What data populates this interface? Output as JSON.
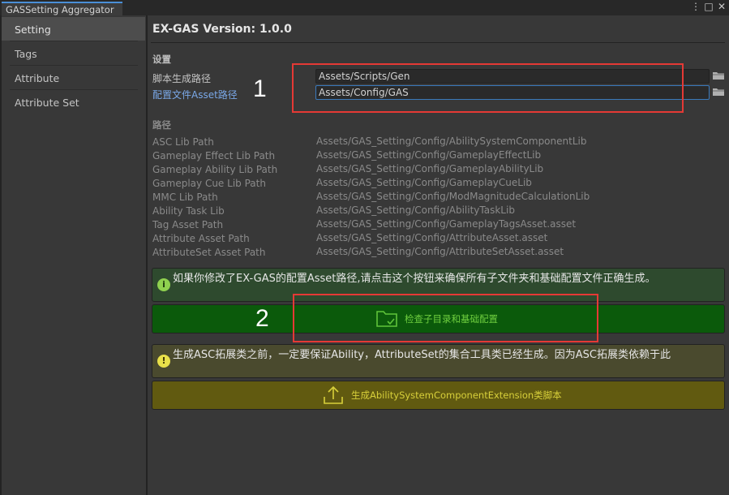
{
  "window": {
    "tab_title": "GASSetting Aggregator",
    "menu_icon": "⋮",
    "maximize_icon": "□",
    "close_icon": "✕"
  },
  "sidebar": {
    "items": [
      {
        "label": "Setting",
        "active": true
      },
      {
        "label": "Tags"
      },
      {
        "label": "Attribute"
      },
      {
        "label": "Attribute Set"
      }
    ]
  },
  "main": {
    "title": "EX-GAS Version: 1.0.0",
    "settings_section": {
      "label": "设置",
      "fields": [
        {
          "label": "脚本生成路径",
          "value": "Assets/Scripts/Gen"
        },
        {
          "label": "配置文件Asset路径",
          "value": "Assets/Config/GAS"
        }
      ]
    },
    "paths_section": {
      "label": "路径",
      "rows": [
        {
          "label": "ASC Lib Path",
          "value": "Assets/GAS_Setting/Config/AbilitySystemComponentLib"
        },
        {
          "label": "Gameplay Effect Lib Path",
          "value": "Assets/GAS_Setting/Config/GameplayEffectLib"
        },
        {
          "label": "Gameplay Ability Lib Path",
          "value": "Assets/GAS_Setting/Config/GameplayAbilityLib"
        },
        {
          "label": "Gameplay Cue Lib Path",
          "value": "Assets/GAS_Setting/Config/GameplayCueLib"
        },
        {
          "label": "MMC Lib Path",
          "value": "Assets/GAS_Setting/Config/ModMagnitudeCalculationLib"
        },
        {
          "label": "Ability Task Lib",
          "value": "Assets/GAS_Setting/Config/AbilityTaskLib"
        },
        {
          "label": "Tag Asset Path",
          "value": "Assets/GAS_Setting/Config/GameplayTagsAsset.asset"
        },
        {
          "label": "Attribute Asset Path",
          "value": "Assets/GAS_Setting/Config/AttributeAsset.asset"
        },
        {
          "label": "AttributeSet Asset Path",
          "value": "Assets/GAS_Setting/Config/AttributeSetAsset.asset"
        }
      ]
    },
    "info_help": {
      "icon": "i",
      "text": "如果你修改了EX-GAS的配置Asset路径,请点击这个按钮来确保所有子文件夹和基础配置文件正确生成。"
    },
    "check_button": {
      "label": "检查子目录和基础配置",
      "icon": "folder-check-icon"
    },
    "warn_help": {
      "icon": "!",
      "text": "生成ASC拓展类之前，一定要保证Ability，AttributeSet的集合工具类已经生成。因为ASC拓展类依赖于此"
    },
    "generate_button": {
      "label": "生成AbilitySystemComponentExtension类脚本",
      "icon": "upload-icon"
    }
  },
  "annotations": {
    "one": "1",
    "two": "2",
    "color": "#e53935"
  },
  "colors": {
    "green_button": "#0b5a0b",
    "yellow_button": "#615a10",
    "link": "#7aa8e8",
    "tab_accent": "#4a8fd8"
  }
}
